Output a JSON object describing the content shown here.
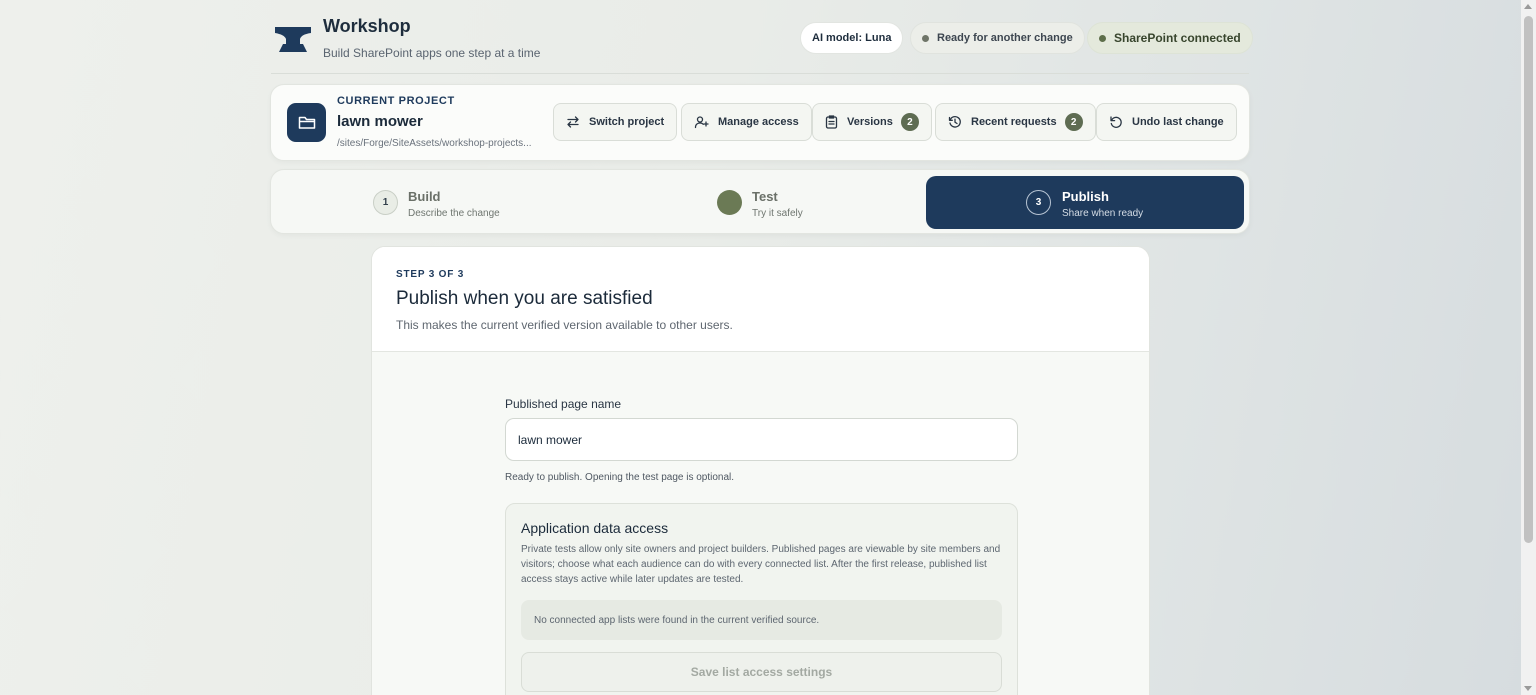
{
  "brand": {
    "title": "Workshop",
    "subtitle": "Build SharePoint apps one step at a time"
  },
  "status": {
    "model": "AI model: Luna",
    "ready": "Ready for another change",
    "sharepoint": "SharePoint connected"
  },
  "project": {
    "kicker": "CURRENT PROJECT",
    "name": "lawn mower",
    "path": "/sites/Forge/SiteAssets/workshop-projects..."
  },
  "toolbar": {
    "switch": "Switch project",
    "manage": "Manage access",
    "versions": "Versions",
    "versions_count": "2",
    "recent": "Recent requests",
    "recent_count": "2",
    "undo": "Undo last change"
  },
  "steps": [
    {
      "number": "1",
      "title": "Build",
      "subtitle": "Describe the change"
    },
    {
      "number": "",
      "title": "Test",
      "subtitle": "Try it safely"
    },
    {
      "number": "3",
      "title": "Publish",
      "subtitle": "Share when ready"
    }
  ],
  "main": {
    "kicker": "STEP 3 OF 3",
    "title": "Publish when you are satisfied",
    "description": "This makes the current verified version available to other users.",
    "field_label": "Published page name",
    "field_value": "lawn mower",
    "hint": "Ready to publish. Opening the test page is optional.",
    "access": {
      "title": "Application data access",
      "description": "Private tests allow only site owners and project builders. Published pages are viewable by site members and visitors; choose what each audience can do with every connected list. After the first release, published list access stays active while later updates are tested.",
      "empty": "No connected app lists were found in the current verified source.",
      "save": "Save list access settings"
    }
  },
  "colors": {
    "brand_navy": "#1e3a5c",
    "success_green": "#5e6c52",
    "background": "#eceee9"
  }
}
